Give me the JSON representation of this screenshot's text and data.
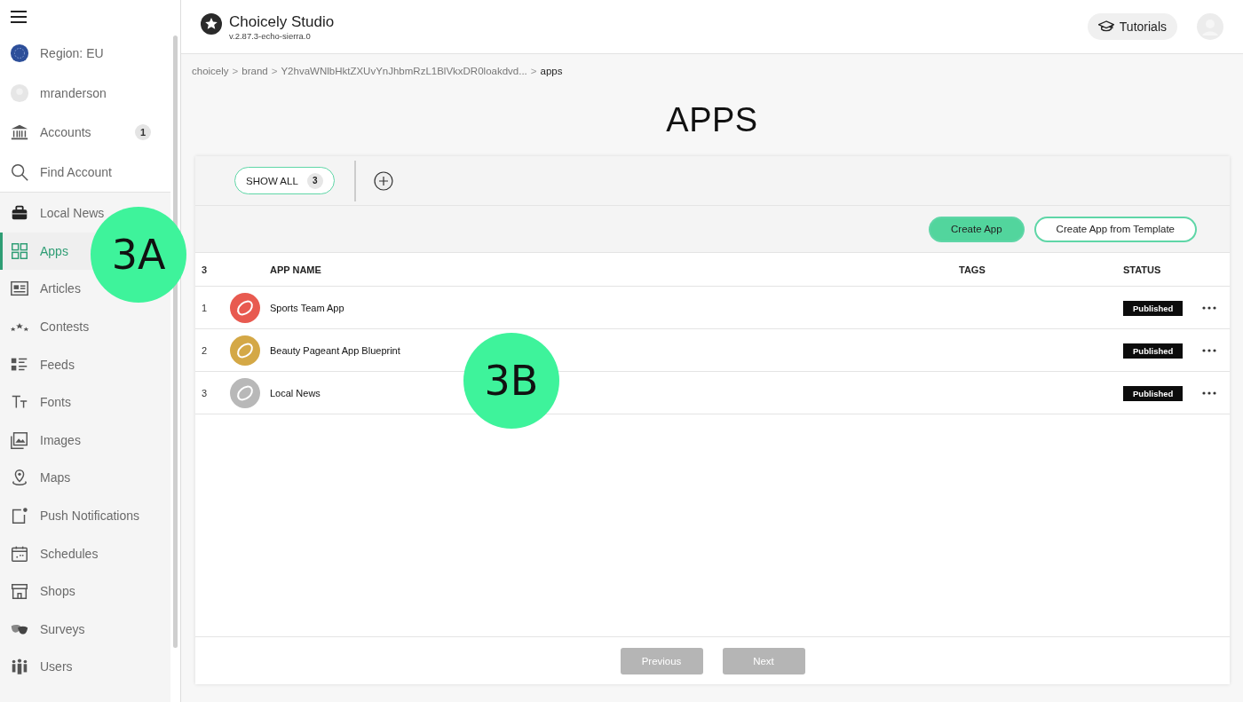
{
  "sidebar": {
    "top_items": [
      {
        "kind": "region",
        "label": "Region: EU"
      },
      {
        "kind": "user",
        "label": "mranderson"
      },
      {
        "kind": "accounts",
        "label": "Accounts",
        "count": "1"
      },
      {
        "kind": "find",
        "label": "Find Account"
      }
    ],
    "nav_items": [
      {
        "label": "Local News",
        "selected": false
      },
      {
        "label": "Apps",
        "selected": true
      },
      {
        "label": "Articles",
        "selected": false
      },
      {
        "label": "Contests",
        "selected": false
      },
      {
        "label": "Feeds",
        "selected": false
      },
      {
        "label": "Fonts",
        "selected": false
      },
      {
        "label": "Images",
        "selected": false
      },
      {
        "label": "Maps",
        "selected": false
      },
      {
        "label": "Push Notifications",
        "selected": false
      },
      {
        "label": "Schedules",
        "selected": false
      },
      {
        "label": "Shops",
        "selected": false
      },
      {
        "label": "Surveys",
        "selected": false
      },
      {
        "label": "Users",
        "selected": false
      }
    ]
  },
  "header": {
    "title": "Choicely Studio",
    "version": "v.2.87.3-echo-sierra.0",
    "tutorials": "Tutorials"
  },
  "breadcrumb": [
    {
      "label": "choicely",
      "selected": false
    },
    {
      "prefix": ">",
      "label": "brand",
      "selected": false
    },
    {
      "prefix": ">",
      "label": "Y2hvaWNlbHktZXUvYnJhbmRzL1BlVkxDR0loakdvd...",
      "selected": false
    },
    {
      "prefix": ">",
      "label": "apps",
      "selected": true
    }
  ],
  "page_title": "APPS",
  "filters": [
    {
      "label": "SHOW ALL",
      "count": "3",
      "selected": true
    }
  ],
  "actions": [
    {
      "kind": "primary",
      "label": "Create App"
    },
    {
      "kind": "outline",
      "label": "Create App from Template"
    }
  ],
  "table": {
    "columns": [
      "3",
      "APP NAME",
      "TAGS",
      "STATUS"
    ],
    "rows": [
      {
        "index": "1",
        "name": "Sports Team App",
        "color": "#e85a50",
        "status": "Published"
      },
      {
        "index": "2",
        "name": "Beauty Pageant App Blueprint",
        "color": "#d4a846",
        "status": "Published"
      },
      {
        "index": "3",
        "name": "Local News",
        "color": "#b8b8b8",
        "status": "Published"
      }
    ]
  },
  "pagination": [
    {
      "label": "Previous",
      "disabled": true
    },
    {
      "label": "Next",
      "disabled": true
    }
  ],
  "callouts": [
    {
      "label": "3A"
    },
    {
      "label": "3B"
    }
  ]
}
